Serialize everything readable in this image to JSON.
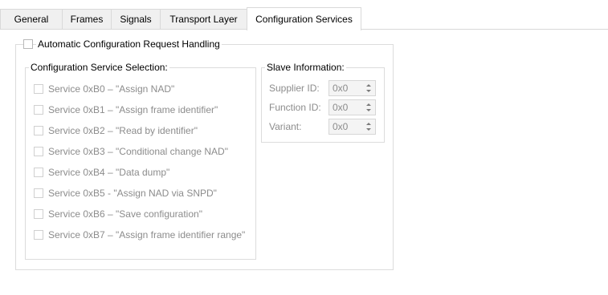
{
  "tabs": [
    {
      "label": "General"
    },
    {
      "label": "Frames"
    },
    {
      "label": "Signals"
    },
    {
      "label": "Transport Layer"
    },
    {
      "label": "Configuration Services"
    }
  ],
  "auto_config": {
    "label": "Automatic Configuration Request Handling",
    "checked": false
  },
  "service_selection": {
    "title": "Configuration Service Selection:",
    "items": [
      {
        "label": "Service 0xB0 – \"Assign NAD\""
      },
      {
        "label": "Service 0xB1 – \"Assign frame identifier\""
      },
      {
        "label": "Service 0xB2 – \"Read by identifier\""
      },
      {
        "label": "Service 0xB3 – \"Conditional change NAD\""
      },
      {
        "label": "Service 0xB4 – \"Data dump\""
      },
      {
        "label": "Service 0xB5 - \"Assign NAD via SNPD\""
      },
      {
        "label": "Service 0xB6 – \"Save configuration\""
      },
      {
        "label": "Service 0xB7 – \"Assign frame identifier range\""
      }
    ]
  },
  "slave_info": {
    "title": "Slave Information:",
    "fields": [
      {
        "label": "Supplier ID:",
        "value": "0x0"
      },
      {
        "label": "Function ID:",
        "value": "0x0"
      },
      {
        "label": "Variant:",
        "value": "0x0"
      }
    ]
  }
}
